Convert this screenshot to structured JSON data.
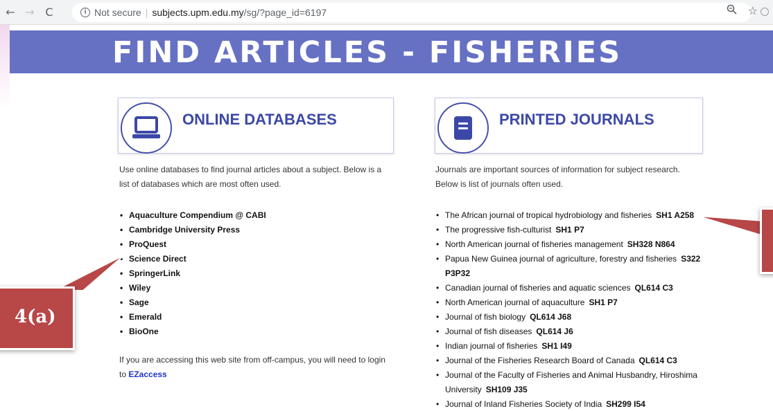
{
  "browser": {
    "security": "Not secure",
    "separator": "|",
    "url_domain": "subjects.upm.edu.my",
    "url_path": "/sg/?page_id=6197"
  },
  "banner": {
    "title": "FIND ARTICLES - FISHERIES"
  },
  "left": {
    "heading": "ONLINE DATABASES",
    "intro_line1": "Use online databases to find journal articles about a subject. Below is a",
    "intro_line2": "list of databases which are most often used.",
    "items": [
      "Aquaculture Compendium @ CABI",
      "Cambridge University Press",
      "ProQuest",
      "Science Direct",
      "SpringerLink",
      "Wiley",
      "Sage",
      "Emerald",
      "BioOne"
    ],
    "offcampus_line1": "If you are accessing this web site from off-campus, you will need to login",
    "offcampus_to": "to ",
    "offcampus_link": "EZaccess"
  },
  "right": {
    "heading": "PRINTED JOURNALS",
    "intro_line1": "Journals are important sources of information for subject research.",
    "intro_line2": "Below is list of journals often used.",
    "journals": [
      {
        "title": "The African journal of tropical hydrobiology and fisheries",
        "call": "SH1 A258"
      },
      {
        "title": " The progressive fish-culturist",
        "call": "SH1 P7"
      },
      {
        "title": "North American journal of fisheries management",
        "call": "SH328 N864"
      },
      {
        "title": "Papua New Guinea journal of agriculture, forestry and fisheries",
        "call": "S322 P3P32"
      },
      {
        "title": "Canadian journal of fisheries and aquatic sciences",
        "call": "QL614 C3"
      },
      {
        "title": "North American journal of aquaculture",
        "call": "SH1 P7"
      },
      {
        "title": "Journal of fish biology",
        "call": "QL614 J68"
      },
      {
        "title": "Journal of fish diseases",
        "call": "QL614 J6"
      },
      {
        "title": "Indian journal of fisheries",
        "call": "SH1 I49"
      },
      {
        "title": "Journal of the Fisheries Research Board of Canada",
        "call": "QL614 C3"
      },
      {
        "title": "Journal of the Faculty of Fisheries and Animal Husbandry, Hiroshima University",
        "call": "SH109 J35"
      },
      {
        "title": "Journal of Inland Fisheries Society of India",
        "call": "SH299 I54"
      }
    ]
  },
  "callouts": {
    "left_label": "4(a)"
  },
  "colors": {
    "banner": "#6671c4",
    "heading": "#3c48a7",
    "callout": "#b84747",
    "link": "#2233cc"
  },
  "icons": [
    "back-arrow-icon",
    "forward-arrow-icon",
    "reload-icon",
    "info-icon",
    "zoom-icon",
    "star-icon",
    "laptop-icon",
    "book-icon"
  ]
}
